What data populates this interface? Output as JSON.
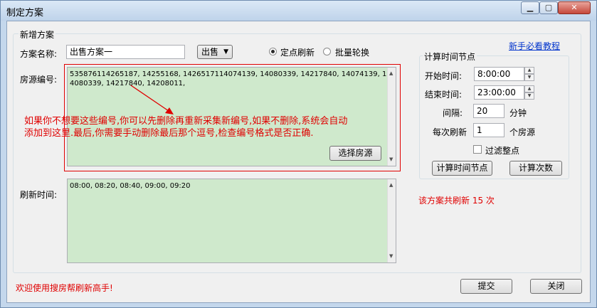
{
  "window": {
    "title": "制定方案"
  },
  "group": {
    "title": "新增方案"
  },
  "plan_name": {
    "label": "方案名称:",
    "value": "出售方案一"
  },
  "trade_type": {
    "selected": "出售"
  },
  "mode": {
    "option1": "定点刷新",
    "option2": "批量轮换",
    "selected": "option1"
  },
  "help_link": "新手必看教程",
  "source": {
    "label": "房源编号:",
    "value": "535876114265187, 14255168, 1426517114074139, 14080339, 14217840, 14074139, 14080339, 14217840, 14208011,",
    "select_button": "选择房源"
  },
  "annotation": {
    "line1": "如果你不想要这些编号,你可以先删除再重新采集新编号,如果不删除,系统会自动",
    "line2": "添加到这里.最后,你需要手动删除最后那个逗号,检查编号格式是否正确."
  },
  "time_group": {
    "title": "计算时间节点",
    "start_label": "开始时间:",
    "start_value": "8:00:00",
    "end_label": "结束时间:",
    "end_value": "23:00:00",
    "interval_label": "间隔:",
    "interval_value": "20",
    "interval_unit": "分钟",
    "per_label": "每次刷新",
    "per_value": "1",
    "per_unit": "个房源",
    "filter_label": "过滤整点",
    "calc_nodes_button": "计算时间节点",
    "calc_count_button": "计算次数"
  },
  "refresh": {
    "label": "刷新时间:",
    "value": "08:00, 08:20, 08:40, 09:00, 09:20"
  },
  "summary": "该方案共刷新 15 次",
  "status": "欢迎使用搜房帮刷新高手!",
  "buttons": {
    "submit": "提交",
    "close": "关闭"
  },
  "colors": {
    "annotation": "#e00000",
    "textarea_bg": "#cfe9cc",
    "link": "#0033cc"
  }
}
